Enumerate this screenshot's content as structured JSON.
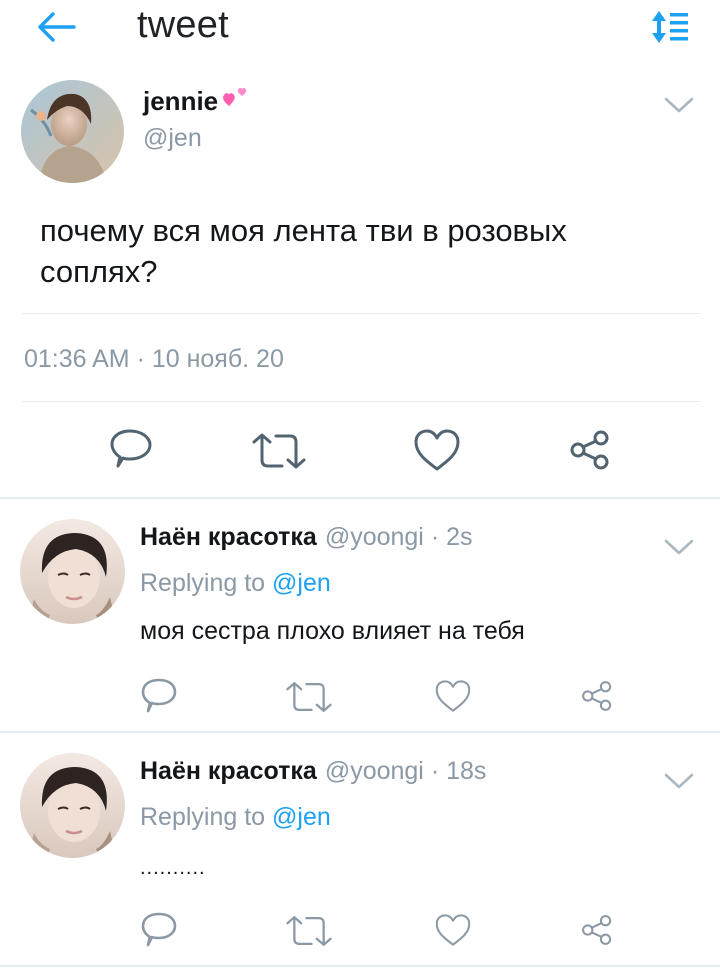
{
  "header": {
    "title": "tweet",
    "back_icon": "arrow-left-icon",
    "sort_icon": "sort-icon",
    "accent": "#1da1f2"
  },
  "main_tweet": {
    "name": "jennie",
    "handle": "@jen",
    "text": "почему вся моя лента тви в розовых соплях?",
    "timestamp": "01:36 AM · 10 нояб. 20",
    "actions": [
      "reply-icon",
      "retweet-icon",
      "like-icon",
      "share-icon"
    ]
  },
  "replies": [
    {
      "name": "Наён красотка",
      "handle": "@yoongi",
      "time": " · 2s",
      "replying_prefix": "Replying to ",
      "replying_to": "@jen",
      "text": "моя сестра плохо влияет на тебя"
    },
    {
      "name": "Наён красотка",
      "handle": "@yoongi",
      "time": " · 18s",
      "replying_prefix": "Replying to ",
      "replying_to": "@jen",
      "text": ".........."
    }
  ],
  "colors": {
    "text": "#14171a",
    "secondary": "#8b98a5",
    "link": "#1da1f2",
    "divider": "#e6ecf0",
    "heart_emoji": "#ff5fae"
  }
}
